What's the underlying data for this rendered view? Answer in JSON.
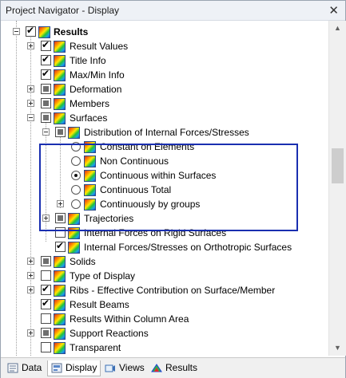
{
  "window": {
    "title": "Project Navigator - Display",
    "close_glyph": "✕"
  },
  "tree": {
    "results": "Results",
    "result_values": "Result Values",
    "title_info": "Title Info",
    "maxmin_info": "Max/Min Info",
    "deformation": "Deformation",
    "members": "Members",
    "surfaces": "Surfaces",
    "distribution": "Distribution of Internal Forces/Stresses",
    "constant_on_elements": "Constant on Elements",
    "non_continuous": "Non Continuous",
    "continuous_within_surfaces": "Continuous within Surfaces",
    "continuous_total": "Continuous Total",
    "continuously_by_groups": "Continuously by groups",
    "trajectories": "Trajectories",
    "internal_forces_rigid": "Internal Forces on Rigid Surfaces",
    "internal_forces_orthotropic": "Internal Forces/Stresses on Orthotropic Surfaces",
    "solids": "Solids",
    "type_of_display": "Type of Display",
    "ribs": "Ribs - Effective Contribution on Surface/Member",
    "result_beams": "Result Beams",
    "results_within_column_area": "Results Within Column Area",
    "support_reactions": "Support Reactions",
    "transparent": "Transparent"
  },
  "tabs": {
    "data": "Data",
    "display": "Display",
    "views": "Views",
    "results": "Results"
  },
  "colors": {
    "highlight_border": "#1a2fb0",
    "accent": "#1d3fd6"
  }
}
